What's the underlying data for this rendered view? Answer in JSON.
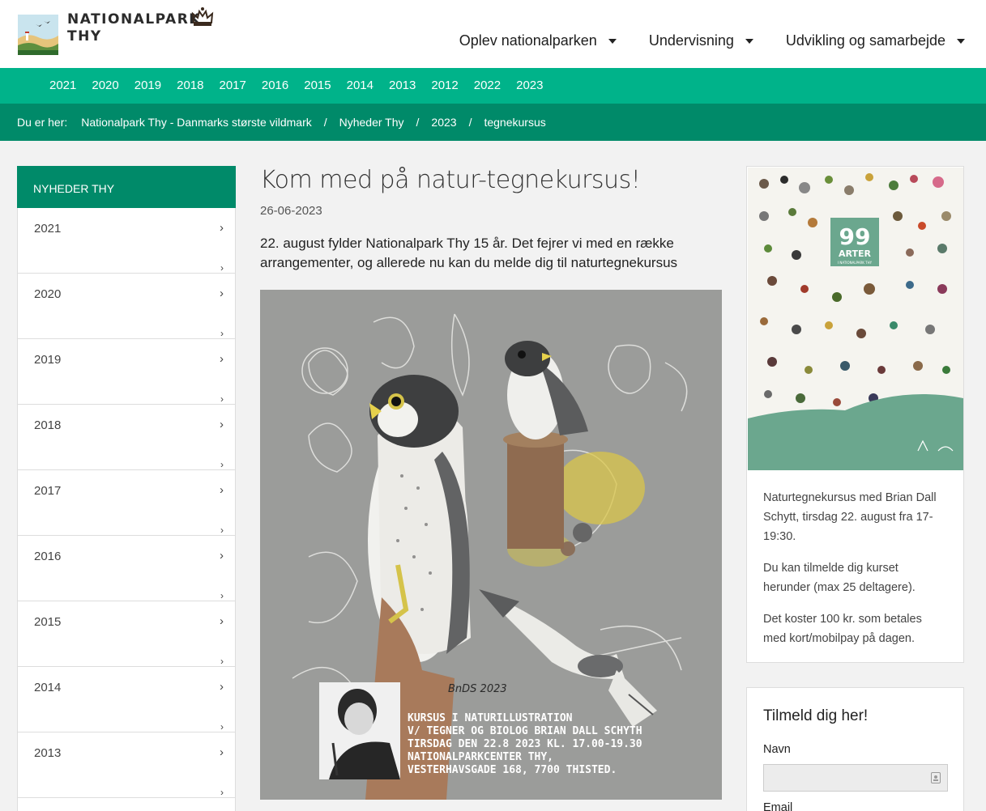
{
  "brand": {
    "name_line1": "NATIONALPARK",
    "name_line2": "THY"
  },
  "mainnav": [
    {
      "label": "Oplev nationalparken"
    },
    {
      "label": "Undervisning"
    },
    {
      "label": "Udvikling og samarbejde"
    }
  ],
  "years": [
    "2021",
    "2020",
    "2019",
    "2018",
    "2017",
    "2016",
    "2015",
    "2014",
    "2013",
    "2012",
    "2022",
    "2023"
  ],
  "breadcrumb": {
    "prefix": "Du er her:",
    "items": [
      "Nationalpark Thy - Danmarks største vildmark",
      "Nyheder Thy",
      "2023",
      "tegnekursus"
    ],
    "separator": "/"
  },
  "sidebar": {
    "title": "NYHEDER THY",
    "items": [
      "2021",
      "2020",
      "2019",
      "2018",
      "2017",
      "2016",
      "2015",
      "2014",
      "2013"
    ],
    "chevron": "›"
  },
  "article": {
    "title": "Kom med på natur-tegnekursus!",
    "date": "26-06-2023",
    "lead": "22. august fylder Nationalpark Thy 15 år. Det fejrer vi med en række arrangementer, og allerede nu kan du melde dig til naturtegnekursus",
    "image": {
      "signature": "BnDS 2023",
      "caption_lines": [
        "KURSUS I NATURILLUSTRATION",
        "V/ TEGNER OG BIOLOG BRIAN DALL SCHYTH",
        "TIRSDAG DEN 22.8 2023 KL. 17.00-19.30",
        "NATIONALPARKCENTER THY,",
        "VESTERHAVSGADE 168, 7700 THISTED."
      ]
    }
  },
  "poster": {
    "number": "99",
    "label": "ARTER",
    "sub": "I NATIONALPARK THY",
    "text": [
      "Naturtegnekursus med Brian Dall Schytt, tirsdag 22. august fra 17-19:30.",
      "Du kan tilmelde dig kurset herunder (max 25 deltagere).",
      "Det koster 100 kr. som betales med kort/mobilpay på dagen."
    ]
  },
  "form": {
    "title": "Tilmeld dig her!",
    "name_label": "Navn",
    "name_value": "",
    "email_label": "Email"
  },
  "colors": {
    "primary_green": "#00b38a",
    "dark_green": "#008a69",
    "background": "#f2f2f2"
  }
}
